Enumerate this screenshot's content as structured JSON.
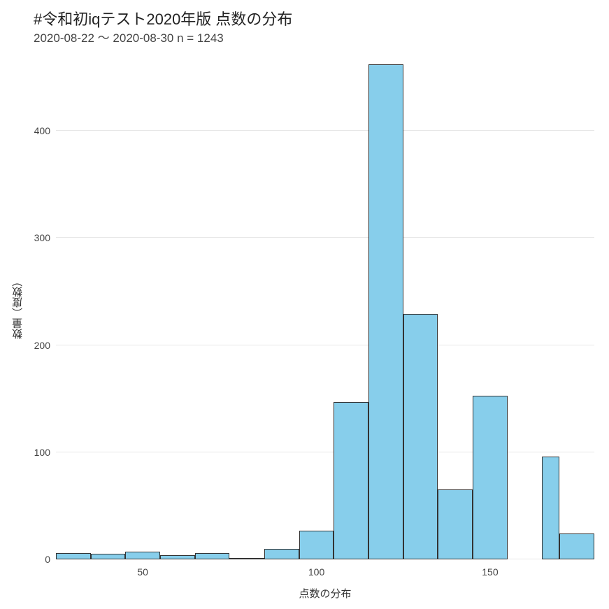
{
  "chart_data": {
    "type": "bar",
    "title": "#令和初iqテスト2020年版 点数の分布",
    "subtitle": "2020-08-22 〜 2020-08-30 n = 1243",
    "xlabel": "点数の分布",
    "ylabel": "数量（度数）",
    "xlim": [
      25,
      180
    ],
    "ylim": [
      0,
      470
    ],
    "x_ticks": [
      50,
      100,
      150
    ],
    "y_ticks": [
      0,
      100,
      200,
      300,
      400
    ],
    "bin_width": 10,
    "bins_left_edge": [
      25,
      35,
      45,
      55,
      65,
      75,
      85,
      95,
      105,
      115,
      125,
      135,
      145,
      155,
      165,
      170
    ],
    "values": [
      6,
      5,
      7,
      4,
      6,
      1,
      10,
      27,
      147,
      462,
      229,
      65,
      153,
      0,
      96,
      24
    ],
    "bar_color": "#87CEEB",
    "bar_border": "#333333",
    "grid_color": "#e6e6e6"
  }
}
